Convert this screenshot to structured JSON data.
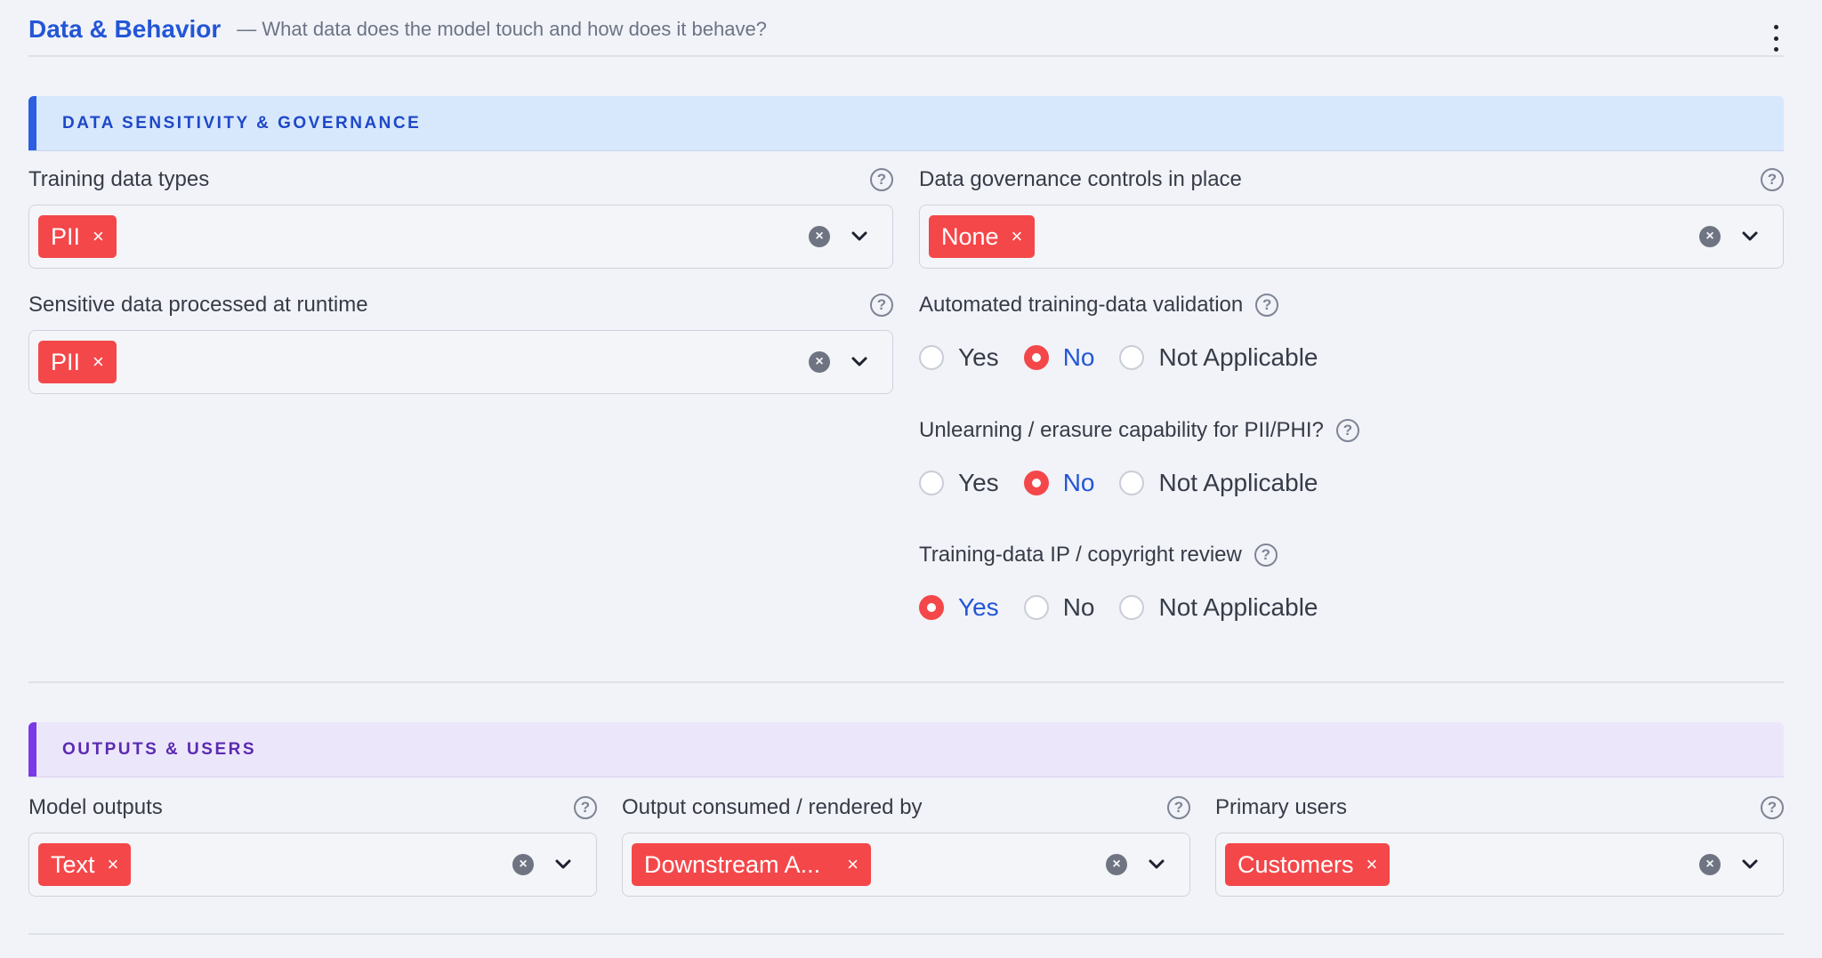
{
  "header": {
    "title": "Data & Behavior",
    "subtitle": "— What data does the model touch and how does it behave?"
  },
  "sections": {
    "data": {
      "title": "DATA SENSITIVITY & GOVERNANCE",
      "training_data_types": {
        "label": "Training data types",
        "chip": "PII"
      },
      "sensitive_runtime": {
        "label": "Sensitive data processed at runtime",
        "chip": "PII"
      },
      "governance_controls": {
        "label": "Data governance controls in place",
        "chip": "None"
      },
      "validation": {
        "label": "Automated training-data validation",
        "options": [
          "Yes",
          "No",
          "Not Applicable"
        ],
        "selected": "No"
      },
      "unlearning": {
        "label": "Unlearning / erasure capability for PII/PHI?",
        "options": [
          "Yes",
          "No",
          "Not Applicable"
        ],
        "selected": "No"
      },
      "ip_review": {
        "label": "Training-data IP / copyright review",
        "options": [
          "Yes",
          "No",
          "Not Applicable"
        ],
        "selected": "Yes"
      }
    },
    "outputs": {
      "title": "OUTPUTS & USERS",
      "model_outputs": {
        "label": "Model outputs",
        "chip": "Text"
      },
      "consumed_by": {
        "label": "Output consumed / rendered by",
        "chip": "Downstream A..."
      },
      "primary_users": {
        "label": "Primary users",
        "chip": "Customers"
      }
    }
  },
  "icons": {
    "help": "?",
    "chip_remove": "×",
    "clear": "×"
  },
  "colors": {
    "accent": "#2356d6",
    "chip": "#f4474a",
    "band_data": "#d8e8fc",
    "band_outputs": "#ece6fb"
  }
}
